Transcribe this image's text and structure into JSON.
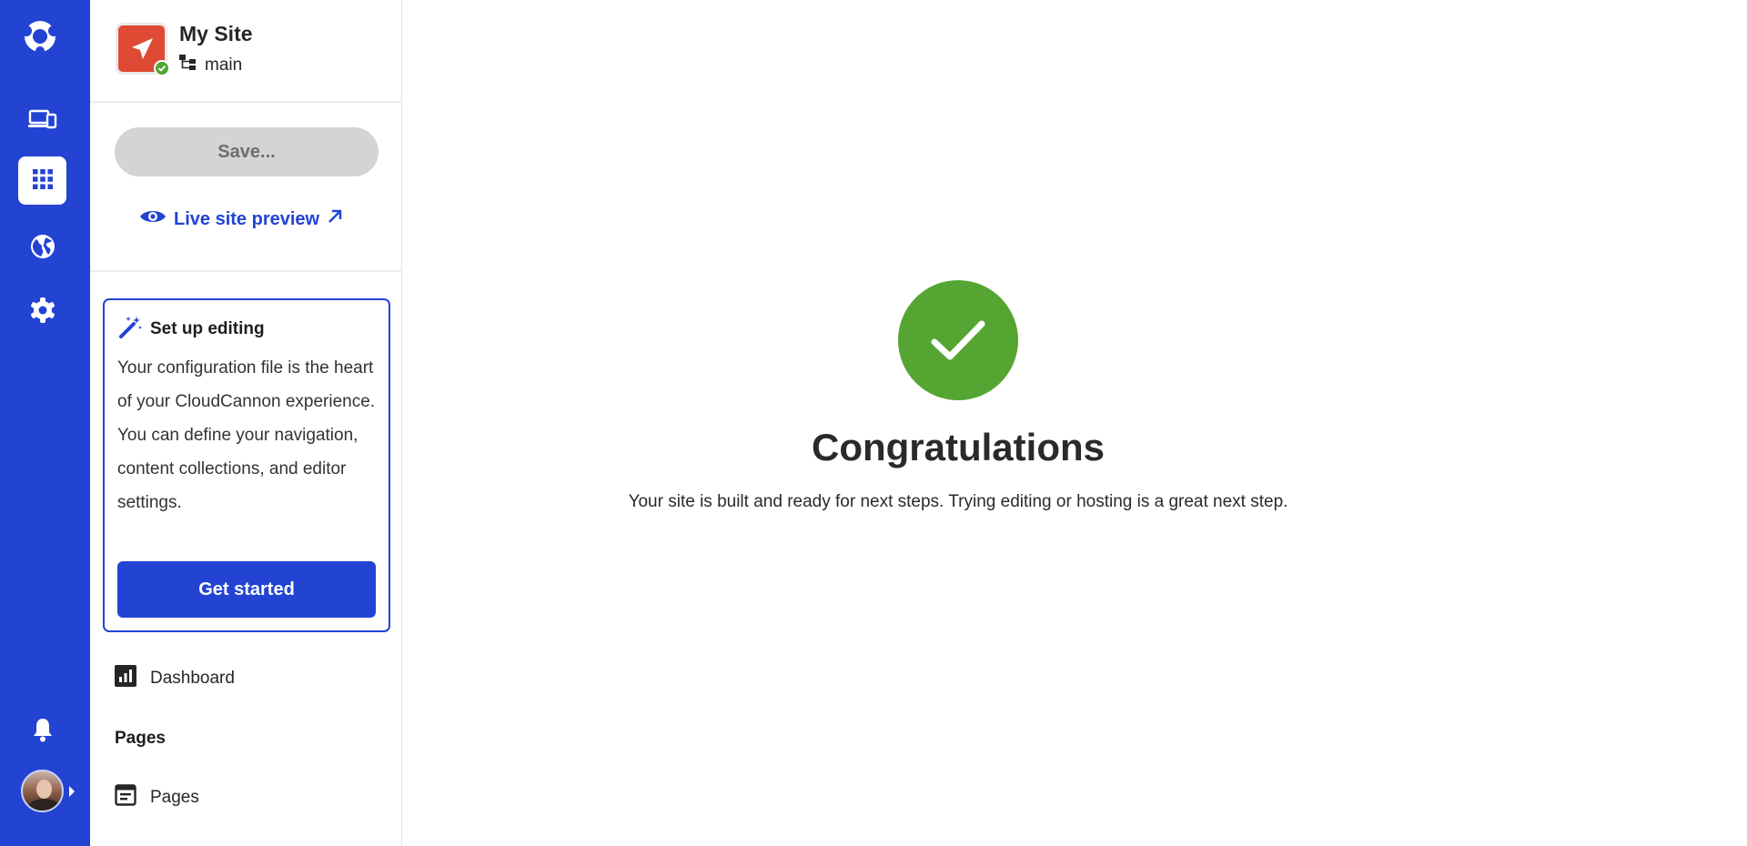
{
  "rail": {
    "items": [
      {
        "icon": "devices-icon",
        "label": "Devices"
      },
      {
        "icon": "apps-grid-icon",
        "label": "Apps",
        "active": true
      },
      {
        "icon": "globe-icon",
        "label": "Hosting"
      },
      {
        "icon": "gear-icon",
        "label": "Settings"
      }
    ],
    "notification_icon": "bell-icon",
    "accent_color": "#2343d3"
  },
  "site": {
    "name": "My Site",
    "branch": "main",
    "icon": "paper-plane-icon",
    "icon_color": "#de4a33",
    "status_color": "#55a532"
  },
  "actions": {
    "save_label": "Save...",
    "preview_label": "Live site preview"
  },
  "setup": {
    "title": "Set up editing",
    "description": "Your configuration file is the heart of your CloudCannon experience. You can define your navigation, content collections, and editor settings.",
    "button_label": "Get started"
  },
  "sidebar": {
    "dashboard_label": "Dashboard",
    "pages_heading": "Pages",
    "pages_label": "Pages"
  },
  "main": {
    "title": "Congratulations",
    "subtitle": "Your site is built and ready for next steps. Trying editing or hosting is a great next step.",
    "success_color": "#55a532"
  }
}
